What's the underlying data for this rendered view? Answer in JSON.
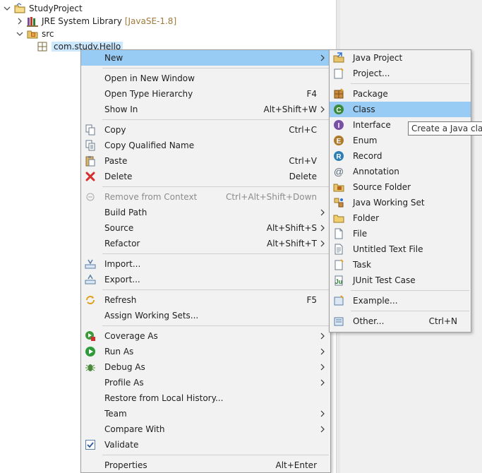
{
  "explorer": {
    "project": "StudyProject",
    "jre_label": "JRE System Library",
    "jre_decoration": "[JavaSE-1.8]",
    "src_label": "src",
    "selected_item": "com.study.Hello"
  },
  "context_menu": [
    {
      "label": "New",
      "accel": "",
      "submenu": true,
      "icon": "",
      "highlighted": true
    },
    {
      "separator": true
    },
    {
      "label": "Open in New Window",
      "accel": "",
      "icon": ""
    },
    {
      "label": "Open Type Hierarchy",
      "accel": "F4",
      "icon": ""
    },
    {
      "label": "Show In",
      "accel": "Alt+Shift+W",
      "submenu": true,
      "icon": ""
    },
    {
      "separator": true
    },
    {
      "label": "Copy",
      "accel": "Ctrl+C",
      "icon": "copy-icon"
    },
    {
      "label": "Copy Qualified Name",
      "accel": "",
      "icon": "copy-qualified-name-icon"
    },
    {
      "label": "Paste",
      "accel": "Ctrl+V",
      "icon": "paste-icon"
    },
    {
      "label": "Delete",
      "accel": "Delete",
      "icon": "delete-icon"
    },
    {
      "separator": true
    },
    {
      "label": "Remove from Context",
      "accel": "Ctrl+Alt+Shift+Down",
      "icon": "remove-from-context-icon",
      "disabled": true
    },
    {
      "label": "Build Path",
      "accel": "",
      "submenu": true,
      "icon": ""
    },
    {
      "label": "Source",
      "accel": "Alt+Shift+S",
      "submenu": true,
      "icon": ""
    },
    {
      "label": "Refactor",
      "accel": "Alt+Shift+T",
      "submenu": true,
      "icon": ""
    },
    {
      "separator": true
    },
    {
      "label": "Import...",
      "accel": "",
      "icon": "import-icon"
    },
    {
      "label": "Export...",
      "accel": "",
      "icon": "export-icon"
    },
    {
      "separator": true
    },
    {
      "label": "Refresh",
      "accel": "F5",
      "icon": "refresh-icon"
    },
    {
      "label": "Assign Working Sets...",
      "accel": "",
      "icon": ""
    },
    {
      "separator": true
    },
    {
      "label": "Coverage As",
      "accel": "",
      "submenu": true,
      "icon": "coverage-icon"
    },
    {
      "label": "Run As",
      "accel": "",
      "submenu": true,
      "icon": "run-icon"
    },
    {
      "label": "Debug As",
      "accel": "",
      "submenu": true,
      "icon": "debug-icon"
    },
    {
      "label": "Profile As",
      "accel": "",
      "submenu": true,
      "icon": ""
    },
    {
      "label": "Restore from Local History...",
      "accel": "",
      "icon": ""
    },
    {
      "label": "Team",
      "accel": "",
      "submenu": true,
      "icon": ""
    },
    {
      "label": "Compare With",
      "accel": "",
      "submenu": true,
      "icon": ""
    },
    {
      "label": "Validate",
      "accel": "",
      "icon": "checkbox-checked-icon"
    },
    {
      "separator": true
    },
    {
      "label": "Properties",
      "accel": "Alt+Enter",
      "icon": ""
    }
  ],
  "new_submenu": [
    {
      "label": "Java Project",
      "accel": "",
      "icon": "java-project-icon"
    },
    {
      "label": "Project...",
      "accel": "",
      "icon": "project-icon"
    },
    {
      "separator": true
    },
    {
      "label": "Package",
      "accel": "",
      "icon": "package-icon"
    },
    {
      "label": "Class",
      "accel": "",
      "icon": "class-icon",
      "highlighted": true
    },
    {
      "label": "Interface",
      "accel": "",
      "icon": "interface-icon"
    },
    {
      "label": "Enum",
      "accel": "",
      "icon": "enum-icon"
    },
    {
      "label": "Record",
      "accel": "",
      "icon": "record-icon"
    },
    {
      "label": "Annotation",
      "accel": "",
      "icon": "annotation-icon"
    },
    {
      "label": "Source Folder",
      "accel": "",
      "icon": "source-folder-icon"
    },
    {
      "label": "Java Working Set",
      "accel": "",
      "icon": "java-working-set-icon"
    },
    {
      "label": "Folder",
      "accel": "",
      "icon": "folder-icon"
    },
    {
      "label": "File",
      "accel": "",
      "icon": "file-icon"
    },
    {
      "label": "Untitled Text File",
      "accel": "",
      "icon": "untitled-text-file-icon"
    },
    {
      "label": "Task",
      "accel": "",
      "icon": "task-icon"
    },
    {
      "label": "JUnit Test Case",
      "accel": "",
      "icon": "junit-test-case-icon"
    },
    {
      "separator": true
    },
    {
      "label": "Example...",
      "accel": "",
      "icon": "example-icon"
    },
    {
      "separator": true
    },
    {
      "label": "Other...",
      "accel": "Ctrl+N",
      "icon": "other-icon"
    }
  ],
  "tooltip": "Create a Java class",
  "colors": {
    "highlight": "#99ccf4",
    "menu_bg": "#f2f2f2",
    "selection": "#cce8ff"
  }
}
